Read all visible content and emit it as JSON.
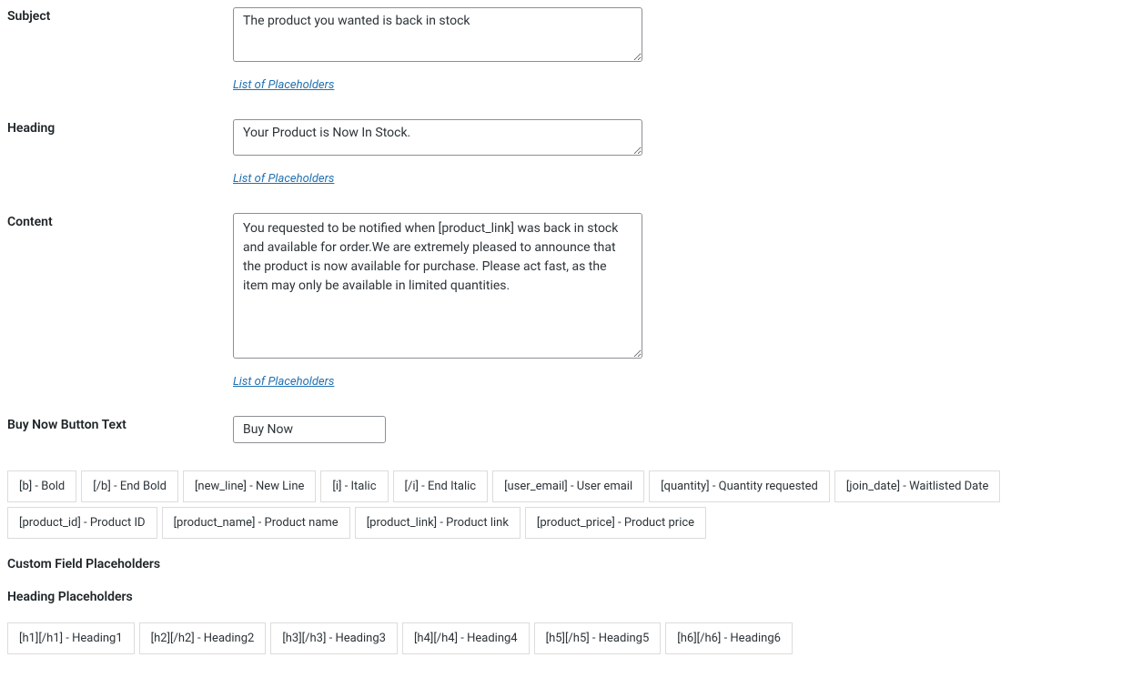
{
  "form": {
    "subject": {
      "label": "Subject",
      "value": "The product you wanted is back in stock",
      "placeholders_link": "List of Placeholders"
    },
    "heading": {
      "label": "Heading",
      "value": "Your Product is Now In Stock.",
      "placeholders_link": "List of Placeholders"
    },
    "content": {
      "label": "Content",
      "value": "You requested to be notified when [product_link] was back in stock and available for order.We are extremely pleased to announce that the product is now available for purchase. Please act fast, as the item may only be available in limited quantities.",
      "placeholders_link": "List of Placeholders"
    },
    "buy_now": {
      "label": "Buy Now Button Text",
      "value": "Buy Now"
    }
  },
  "placeholders": [
    "[b] - Bold",
    "[/b] - End Bold",
    "[new_line] - New Line",
    "[i] - Italic",
    "[/i] - End Italic",
    "[user_email] - User email",
    "[quantity] - Quantity requested",
    "[join_date] - Waitlisted Date",
    "[product_id] - Product ID",
    "[product_name] - Product name",
    "[product_link] - Product link",
    "[product_price] - Product price"
  ],
  "sections": {
    "custom_field": "Custom Field Placeholders",
    "heading": "Heading Placeholders"
  },
  "heading_placeholders": [
    "[h1][/h1] - Heading1",
    "[h2][/h2] - Heading2",
    "[h3][/h3] - Heading3",
    "[h4][/h4] - Heading4",
    "[h5][/h5] - Heading5",
    "[h6][/h6] - Heading6"
  ]
}
